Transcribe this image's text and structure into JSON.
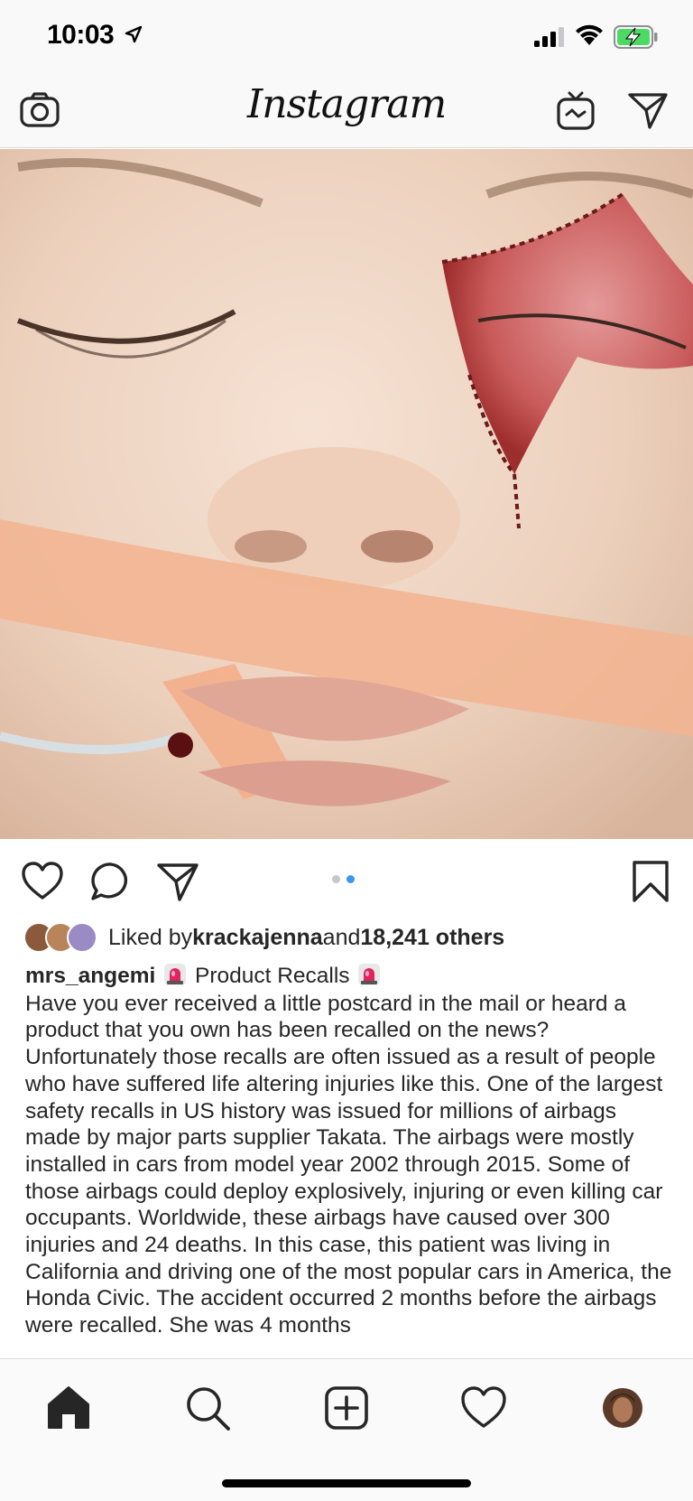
{
  "status_bar": {
    "time": "10:03"
  },
  "header": {
    "brand": "Instagram"
  },
  "post": {
    "carousel": {
      "count": 2,
      "active_index": 1
    },
    "likes": {
      "prefix": "Liked by ",
      "user": "krackajenna",
      "middle": " and ",
      "count": "18,241 others"
    },
    "caption": {
      "username": "mrs_angemi",
      "headline": "Product Recalls",
      "text": "Have you ever received a little postcard in the mail or heard a product that you own has been recalled on the news? Unfortunately those recalls are often issued as a result of people who have suffered life altering injuries like this. One of the largest safety recalls in US history was issued for millions of airbags made by major parts supplier Takata. The airbags were mostly installed in cars from model year 2002 through 2015. Some of those airbags could deploy explosively, injuring or even killing car occupants. Worldwide, these airbags have caused over 300 injuries and 24 deaths. In this case, this patient was living in California and driving one of the most popular cars in America, the Honda Civic. The accident occurred 2 months before the airbags were recalled. She was 4 months"
    }
  },
  "icons": {
    "camera": "camera-icon",
    "igtv": "igtv-icon",
    "direct": "paper-plane-icon",
    "like": "heart-icon",
    "comment": "comment-icon",
    "share": "paper-plane-icon",
    "save": "bookmark-icon",
    "tabs": [
      "home-icon",
      "search-icon",
      "add-post-icon",
      "activity-heart-icon",
      "profile-avatar"
    ]
  },
  "colors": {
    "accent_dot": "#3897f0",
    "battery_green": "#4cd964",
    "siren_red": "#e0245e"
  }
}
